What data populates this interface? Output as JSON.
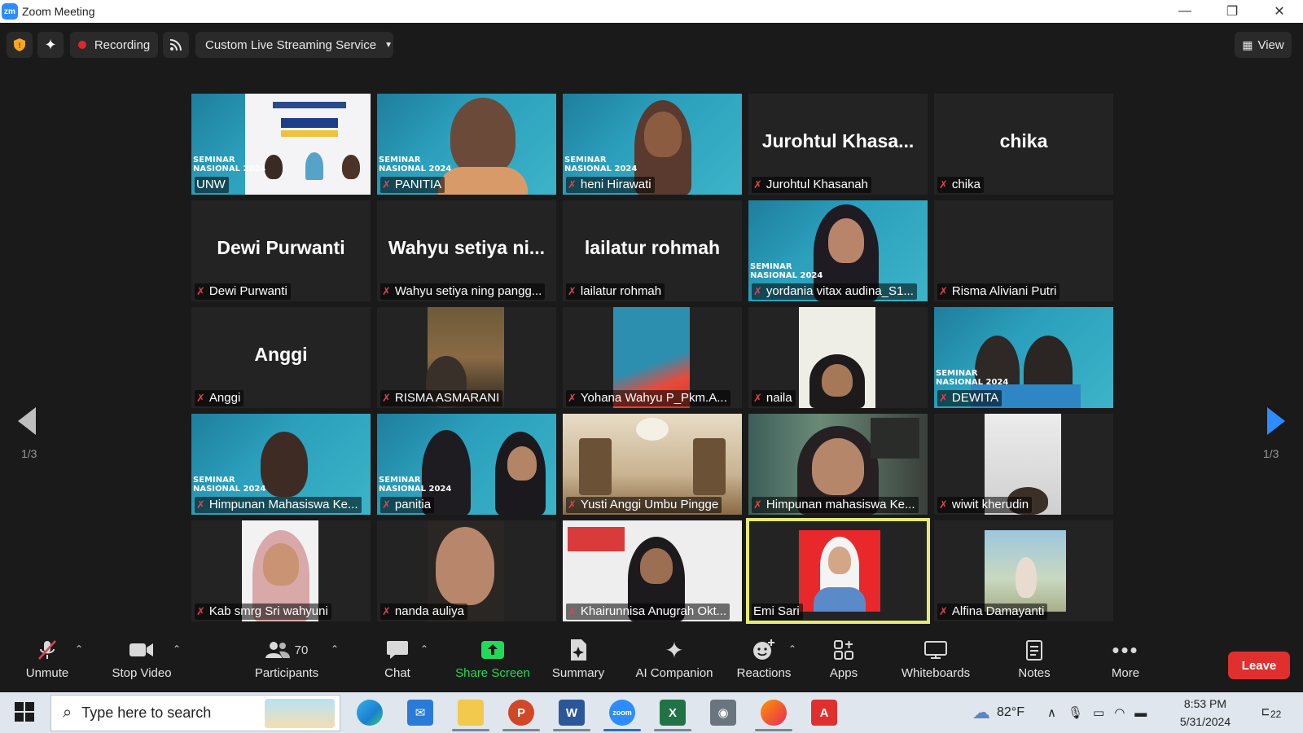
{
  "window": {
    "title": "Zoom Meeting",
    "logo": "zm",
    "minimize": "—",
    "restore": "❐",
    "close": "✕"
  },
  "topbar": {
    "recording_label": "Recording",
    "streaming_label": "Custom Live Streaming Service",
    "view_label": "View",
    "shield_icon": "shield-icon",
    "sparkle_icon": "sparkle-icon"
  },
  "gallery": {
    "page_indicator_left": "1/3",
    "page_indicator_right": "1/3",
    "seminar_text": "SEMINAR\nNASIONAL 2024",
    "tiles": [
      {
        "display_name": "",
        "label": "UNW",
        "muted": false,
        "type": "poster"
      },
      {
        "display_name": "",
        "label": "PANITIA",
        "muted": true,
        "type": "video"
      },
      {
        "display_name": "",
        "label": "heni Hirawati",
        "muted": true,
        "type": "video"
      },
      {
        "display_name": "Jurohtul  Khasa...",
        "label": "Jurohtul Khasanah",
        "muted": true,
        "type": "name"
      },
      {
        "display_name": "chika",
        "label": "chika",
        "muted": true,
        "type": "name"
      },
      {
        "display_name": "Dewi Purwanti",
        "label": "Dewi Purwanti",
        "muted": true,
        "type": "name"
      },
      {
        "display_name": "Wahyu  setiya  ni...",
        "label": "Wahyu setiya ning pangg...",
        "muted": true,
        "type": "name"
      },
      {
        "display_name": "lailatur rohmah",
        "label": "lailatur rohmah",
        "muted": true,
        "type": "name"
      },
      {
        "display_name": "",
        "label": "yordania vitax audina_S1...",
        "muted": true,
        "type": "video"
      },
      {
        "display_name": "",
        "label": "Risma Aliviani Putri",
        "muted": true,
        "type": "blank"
      },
      {
        "display_name": "Anggi",
        "label": "Anggi",
        "muted": true,
        "type": "name"
      },
      {
        "display_name": "",
        "label": "RISMA ASMARANI",
        "muted": true,
        "type": "video"
      },
      {
        "display_name": "",
        "label": "Yohana Wahyu P_Pkm.A...",
        "muted": true,
        "type": "video"
      },
      {
        "display_name": "",
        "label": "naila",
        "muted": true,
        "type": "video"
      },
      {
        "display_name": "",
        "label": "DEWITA",
        "muted": true,
        "type": "video"
      },
      {
        "display_name": "",
        "label": "Himpunan Mahasiswa Ke...",
        "muted": true,
        "type": "video"
      },
      {
        "display_name": "",
        "label": "panitia",
        "muted": true,
        "type": "video"
      },
      {
        "display_name": "",
        "label": "Yusti Anggi Umbu Pingge",
        "muted": true,
        "type": "video"
      },
      {
        "display_name": "",
        "label": "Himpunan mahasiswa Ke...",
        "muted": true,
        "type": "video"
      },
      {
        "display_name": "",
        "label": "wiwit kherudin",
        "muted": true,
        "type": "video"
      },
      {
        "display_name": "",
        "label": "Kab smrg Sri wahyuni",
        "muted": true,
        "type": "video"
      },
      {
        "display_name": "",
        "label": "nanda auliya",
        "muted": true,
        "type": "video"
      },
      {
        "display_name": "",
        "label": "Khairunnisa Anugrah Okt...",
        "muted": true,
        "type": "video"
      },
      {
        "display_name": "",
        "label": "Emi Sari",
        "muted": false,
        "type": "video",
        "active_speaker": true
      },
      {
        "display_name": "",
        "label": "Alfina Damayanti",
        "muted": true,
        "type": "video"
      }
    ]
  },
  "bottombar": {
    "unmute": "Unmute",
    "stop_video": "Stop Video",
    "participants": "Participants",
    "participants_count": "70",
    "chat": "Chat",
    "share_screen": "Share Screen",
    "summary": "Summary",
    "ai_companion": "AI Companion",
    "reactions": "Reactions",
    "apps": "Apps",
    "whiteboards": "Whiteboards",
    "notes": "Notes",
    "more": "More",
    "leave": "Leave"
  },
  "taskbar": {
    "search_placeholder": "Type here to search",
    "weather": "82°F",
    "time": "8:53 PM",
    "date": "5/31/2024",
    "notifications": "22",
    "apps": [
      "edge-icon",
      "mail-icon",
      "file-explorer-icon",
      "powerpoint-icon",
      "word-icon",
      "zoom-icon",
      "excel-icon",
      "camera-icon",
      "firefox-icon",
      "acrobat-icon"
    ]
  },
  "colors": {
    "accent_blue": "#2d8cff",
    "share_green": "#23d959",
    "leave_red": "#e02f2f",
    "active_speaker": "#e6ea72",
    "mute_red": "#e0424c"
  }
}
